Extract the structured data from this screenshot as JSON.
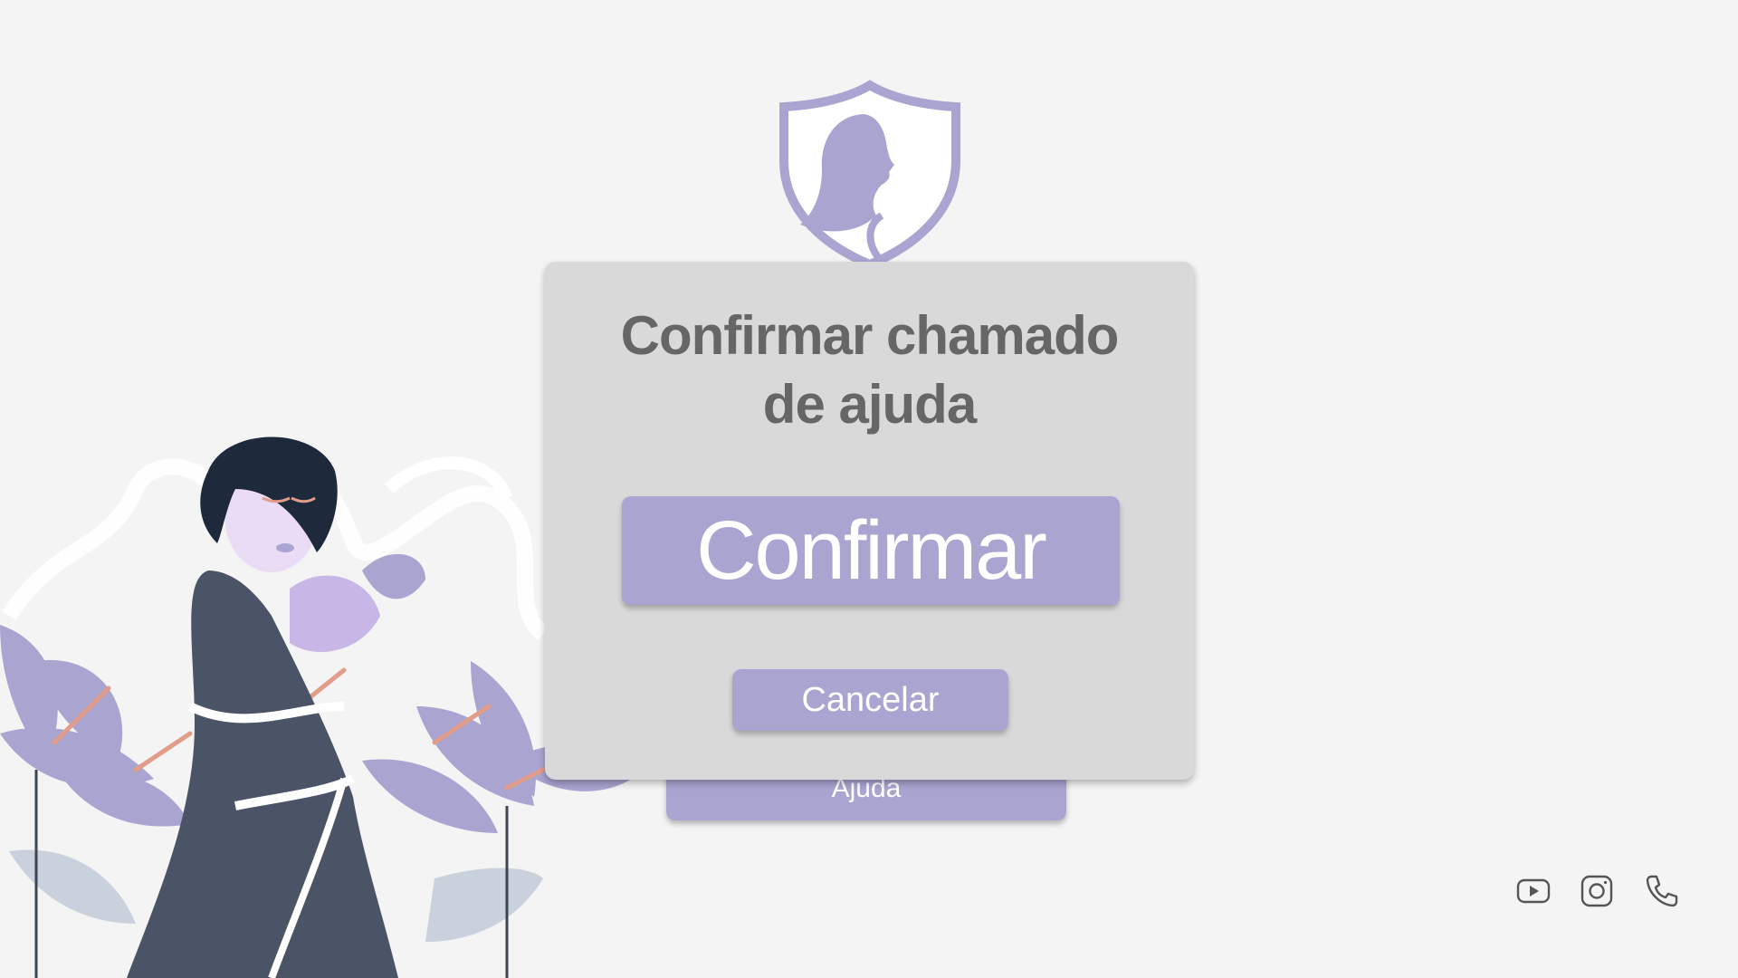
{
  "logo": {
    "icon": "shield-woman-icon"
  },
  "dialog": {
    "title_line1": "Confirmar chamado",
    "title_line2": "de ajuda",
    "confirm_label": "Confirmar",
    "cancel_label": "Cancelar"
  },
  "background": {
    "help_label": "Ajuda",
    "illustration": "woman-with-flowers-illustration"
  },
  "footer": {
    "social": [
      {
        "icon": "youtube-icon"
      },
      {
        "icon": "instagram-icon"
      },
      {
        "icon": "phone-icon"
      }
    ]
  },
  "colors": {
    "background": "#f4f4f4",
    "accent": "#a9a4d0",
    "modal": "#d9d9d9",
    "title_text": "#666666",
    "button_text": "#ffffff"
  }
}
